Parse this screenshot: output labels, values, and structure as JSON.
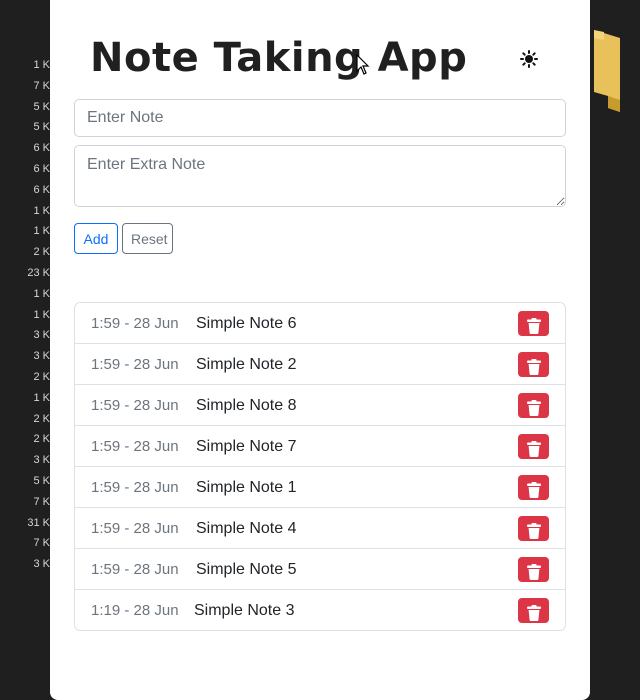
{
  "background": {
    "file_sizes": [
      "1 K",
      "7 K",
      "5 K",
      "5 K",
      "6 K",
      "6 K",
      "6 K",
      "1 K",
      "1 K",
      "2 K",
      "23 K",
      "1 K",
      "1 K",
      "3 K",
      "3 K",
      "2 K",
      "1 K",
      "2 K",
      "2 K",
      "3 K",
      "5 K",
      "7 K",
      "31 K",
      "7 K",
      "3 K"
    ],
    "folder_icon": "folder-icon"
  },
  "app": {
    "title": "Note Taking App",
    "theme_toggle_icon": "sun-icon",
    "note_input": {
      "placeholder": "Enter Note",
      "value": ""
    },
    "extra_note_input": {
      "placeholder": "Enter Extra Note",
      "value": ""
    },
    "add_label": "Add",
    "reset_label": "Reset",
    "delete_icon": "trash-icon",
    "colors": {
      "primary": "#0d6efd",
      "secondary": "#6c757d",
      "danger": "#dc3545"
    }
  },
  "notes": [
    {
      "time": "1:59 - 28 Jun",
      "text": "Simple Note 6"
    },
    {
      "time": "1:59 - 28 Jun",
      "text": "Simple Note 2"
    },
    {
      "time": "1:59 - 28 Jun",
      "text": "Simple Note 8"
    },
    {
      "time": "1:59 - 28 Jun",
      "text": "Simple Note 7"
    },
    {
      "time": "1:59 - 28 Jun",
      "text": "Simple Note 1"
    },
    {
      "time": "1:59 - 28 Jun",
      "text": "Simple Note 4"
    },
    {
      "time": "1:59 - 28 Jun",
      "text": "Simple Note 5"
    },
    {
      "time": "1:19 - 28 Jun",
      "text": "Simple Note 3"
    }
  ]
}
